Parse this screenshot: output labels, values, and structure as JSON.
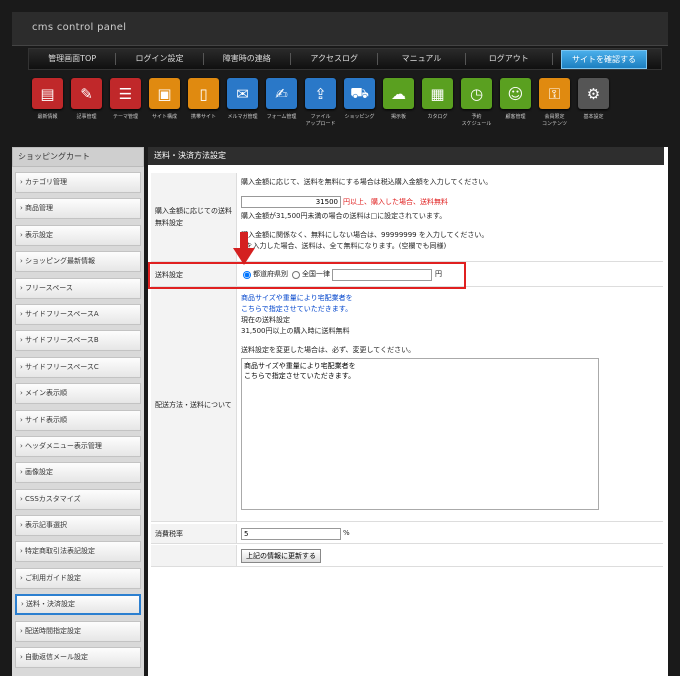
{
  "app": {
    "brand": "cms control panel"
  },
  "nav": {
    "items": [
      "管理画面TOP",
      "ログイン設定",
      "障害時の連絡",
      "アクセスログ",
      "マニュアル",
      "ログアウト"
    ],
    "site_button": "サイトを確認する"
  },
  "icons": [
    {
      "label": "最新情報",
      "name": "news-icon",
      "color": "#c0282a"
    },
    {
      "label": "記事管理",
      "name": "article-icon",
      "color": "#c0282a"
    },
    {
      "label": "テーマ管理",
      "name": "theme-icon",
      "color": "#c0282a"
    },
    {
      "label": "サイト構成",
      "name": "site-structure-icon",
      "color": "#e08a10"
    },
    {
      "label": "携帯サイト",
      "name": "mobile-site-icon",
      "color": "#e08a10"
    },
    {
      "label": "メルマガ管理",
      "name": "mail-magazine-icon",
      "color": "#2a78c8"
    },
    {
      "label": "フォーム管理",
      "name": "form-icon",
      "color": "#2a78c8"
    },
    {
      "label": "ファイル\nアップロード",
      "name": "file-upload-icon",
      "color": "#2a78c8"
    },
    {
      "label": "ショッピング",
      "name": "shopping-icon",
      "color": "#2a78c8"
    },
    {
      "label": "掲示板",
      "name": "bbs-icon",
      "color": "#5aa020"
    },
    {
      "label": "カタログ",
      "name": "catalog-icon",
      "color": "#5aa020"
    },
    {
      "label": "予約\nスケジュール",
      "name": "schedule-icon",
      "color": "#5aa020"
    },
    {
      "label": "顧客管理",
      "name": "customer-icon",
      "color": "#5aa020"
    },
    {
      "label": "会員限定\nコンテンツ",
      "name": "member-icon",
      "color": "#e08a10"
    },
    {
      "label": "基本設定",
      "name": "basic-settings-icon",
      "color": "#555555"
    }
  ],
  "sidebar": {
    "title": "ショッピングカート",
    "items": [
      "カテゴリ管理",
      "商品管理",
      "表示設定",
      "ショッピング最新情報",
      "フリースペース",
      "サイドフリースペースA",
      "サイドフリースペースB",
      "サイドフリースペースC",
      "メイン表示順",
      "サイド表示順",
      "ヘッダメニュー表示管理",
      "画像設定",
      "CSSカスタマイズ",
      "表示記事選択",
      "特定商取引法表記設定",
      "ご利用ガイド設定",
      "送料・決済設定",
      "配送時間指定設定",
      "自動返信メール設定"
    ]
  },
  "main": {
    "title": "送料・決済方法設定",
    "free": {
      "label": "購入金額に応じての送料無料設定",
      "desc": "購入金額に応じて、送料を無料にする場合は税込購入金額を入力してください。",
      "amount": "31500",
      "unit_note": "円以上、購入した場合、送料無料",
      "current": "購入金額が31,500円未満の場合の送料は□に設定されています。",
      "note1": "購入金額に関係なく、無料にしない場合は、99999999 を入力してください。",
      "note2": "0を入力した場合、送料は、全て無料になります。(空欄でも同様)"
    },
    "shipping": {
      "label": "送料設定",
      "radio1": "都道府県別",
      "radio2": "全国一律",
      "yen": "円"
    },
    "method": {
      "label": "配送方法・送料について",
      "line1": "商品サイズや重量により宅配業者を",
      "line2": "こちらで指定させていただきます。",
      "cur_label": "現在の送料設定",
      "cur_value": "31,500円以上の購入時に送料無料",
      "instr": "送料設定を変更した場合は、必ず、変更してください。",
      "textarea": "商品サイズや重量により宅配業者を\nこちらで指定させていただきます。"
    },
    "tax": {
      "label": "消費税率",
      "value": "5",
      "unit": "%"
    },
    "submit": "上記の情報に更新する"
  }
}
